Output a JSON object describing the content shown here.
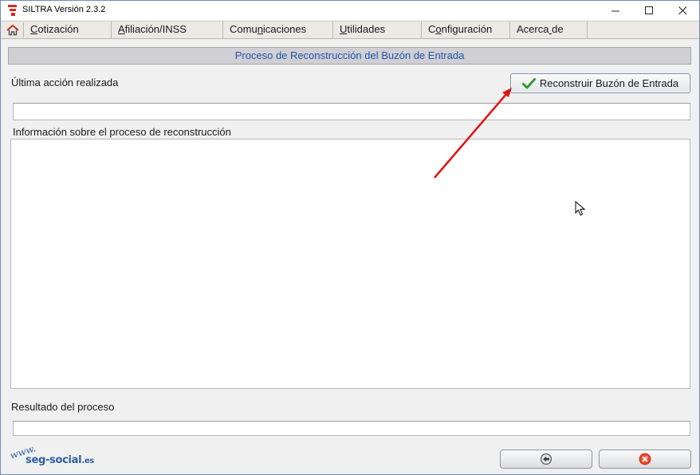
{
  "window": {
    "title": "SILTRA Versión 2.3.2",
    "controls": {
      "minimize": "—",
      "maximize": "☐",
      "close": "✕"
    }
  },
  "menu": {
    "home_icon": "home-icon",
    "items": [
      {
        "label": "Cotización",
        "shortcut_index": 0
      },
      {
        "label": "Afiliación/INSS",
        "shortcut_index": 0
      },
      {
        "label": "Comunicaciones",
        "shortcut_index": 4
      },
      {
        "label": "Utilidades",
        "shortcut_index": 0
      },
      {
        "label": "Configuración",
        "shortcut_index": 1
      },
      {
        "label": "Acerca de",
        "shortcut_index": 6
      }
    ]
  },
  "section": {
    "title": "Proceso de Reconstrucción del Buzón de Entrada"
  },
  "last_action": {
    "label": "Última acción realizada",
    "value": ""
  },
  "rebuild_button": {
    "label": "Reconstruir Buzón de Entrada",
    "icon": "checkmark-icon"
  },
  "info": {
    "label": "Información sobre el proceso de reconstrucción",
    "value": ""
  },
  "result": {
    "label": "Resultado del proceso",
    "value": ""
  },
  "footer": {
    "logo_text": "www.seg-social.es",
    "back_icon": "back-arrow-icon",
    "close_icon": "close-circle-icon"
  },
  "colors": {
    "header_text": "#1f55a8",
    "check_green": "#2e9e2e",
    "annotation_arrow": "#e01414",
    "close_red": "#d9391c"
  }
}
